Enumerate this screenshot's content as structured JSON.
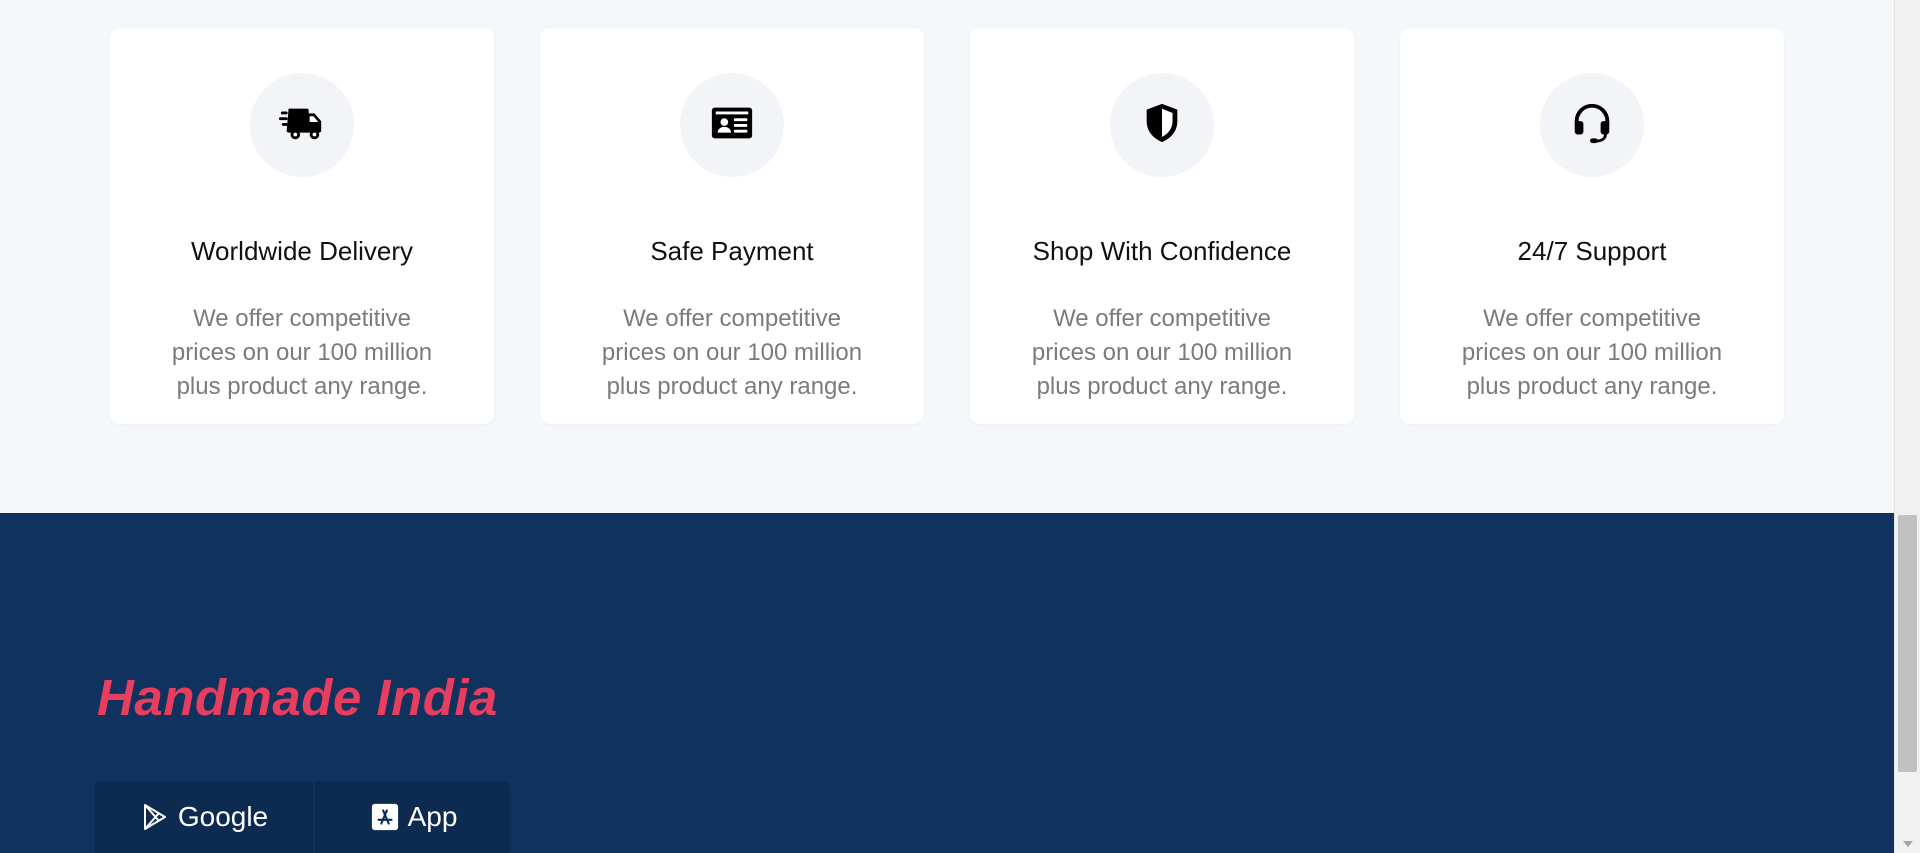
{
  "features": [
    {
      "icon": "truck-fast-icon",
      "title": "Worldwide Delivery",
      "text": "We offer competitive prices on our 100 million plus product any range."
    },
    {
      "icon": "id-card-icon",
      "title": "Safe Payment",
      "text": "We offer competitive prices on our 100 million plus product any range."
    },
    {
      "icon": "shield-icon",
      "title": "Shop With Confidence",
      "text": "We offer competitive prices on our 100 million plus product any range."
    },
    {
      "icon": "headset-icon",
      "title": "24/7 Support",
      "text": "We offer competitive prices on our 100 million plus product any range."
    }
  ],
  "footer": {
    "brand": "Handmade India",
    "google_label": "Google",
    "app_label": "App"
  },
  "colors": {
    "brand": "#e73d5f",
    "footer_bg": "#10325e",
    "features_bg": "#f5f8fb"
  }
}
